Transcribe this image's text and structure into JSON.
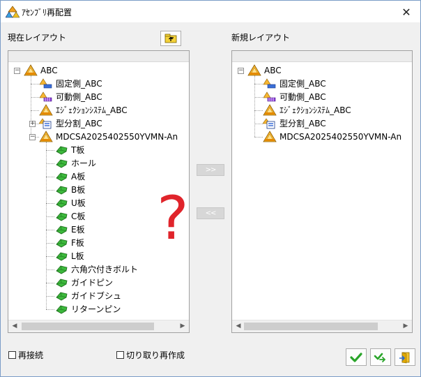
{
  "window": {
    "title": "ｱｾﾝﾌﾞﾘ再配置",
    "close_glyph": "✕"
  },
  "current_layout": {
    "label": "現在レイアウト",
    "tree": [
      {
        "label": "ABC",
        "icon": "assembly-icon",
        "level": 0,
        "expander": "−"
      },
      {
        "label": "固定側_ABC",
        "icon": "fixed-side-assembly-icon",
        "level": 1
      },
      {
        "label": "可動側_ABC",
        "icon": "moving-side-assembly-icon",
        "level": 1
      },
      {
        "label": "ｴｼﾞｪｸｼｮﾝｼｽﾃﾑ_ABC",
        "icon": "assembly-icon",
        "level": 1
      },
      {
        "label": "型分割_ABC",
        "icon": "mold-split-icon",
        "level": 1,
        "expander": "+"
      },
      {
        "label": "MDCSA2025402550YVMN-An",
        "icon": "assembly-icon",
        "level": 1,
        "expander": "−"
      },
      {
        "label": "T板",
        "icon": "part-icon",
        "level": 2
      },
      {
        "label": "ホール",
        "icon": "part-icon",
        "level": 2
      },
      {
        "label": "A板",
        "icon": "part-icon",
        "level": 2
      },
      {
        "label": "B板",
        "icon": "part-icon",
        "level": 2
      },
      {
        "label": "U板",
        "icon": "part-icon",
        "level": 2
      },
      {
        "label": "C板",
        "icon": "part-icon",
        "level": 2
      },
      {
        "label": "E板",
        "icon": "part-icon",
        "level": 2
      },
      {
        "label": "F板",
        "icon": "part-icon",
        "level": 2
      },
      {
        "label": "L板",
        "icon": "part-icon",
        "level": 2
      },
      {
        "label": "六角穴付きボルト",
        "icon": "part-icon",
        "level": 2
      },
      {
        "label": "ガイドピン",
        "icon": "part-icon",
        "level": 2
      },
      {
        "label": "ガイドブシュ",
        "icon": "part-icon",
        "level": 2
      },
      {
        "label": "リターンピン",
        "icon": "part-icon",
        "level": 2
      }
    ]
  },
  "new_layout": {
    "label": "新規レイアウト",
    "tree": [
      {
        "label": "ABC",
        "icon": "assembly-icon",
        "level": 0,
        "expander": "−"
      },
      {
        "label": "固定側_ABC",
        "icon": "fixed-side-assembly-icon",
        "level": 1
      },
      {
        "label": "可動側_ABC",
        "icon": "moving-side-assembly-icon",
        "level": 1
      },
      {
        "label": "ｴｼﾞｪｸｼｮﾝｼｽﾃﾑ_ABC",
        "icon": "assembly-icon",
        "level": 1
      },
      {
        "label": "型分割_ABC",
        "icon": "mold-split-icon",
        "level": 1
      },
      {
        "label": "MDCSA2025402550YVMN-An",
        "icon": "assembly-icon",
        "level": 1
      }
    ]
  },
  "middle_buttons": {
    "move_right": ">>",
    "move_left": "<<"
  },
  "annotation": "?",
  "options": {
    "reconnect": "再接続",
    "recreate_cut": "切り取り再作成"
  },
  "colors": {
    "accent_green": "#2aa52a",
    "question_red": "#e0242b",
    "part_green": "#38b038",
    "assembly_orange": "#f0a020"
  }
}
